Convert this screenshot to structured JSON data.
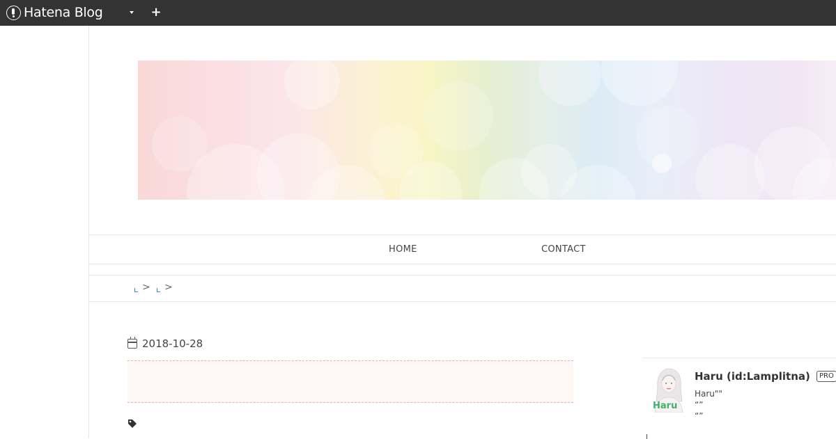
{
  "topbar": {
    "logo_text": "Hatena Blog",
    "logo_icon": "hatena-logo-icon",
    "menu_caret_icon": "caret-down-icon",
    "add_icon": "plus-icon",
    "add_glyph": "+"
  },
  "nav": {
    "items": [
      {
        "label": "HOME"
      },
      {
        "label": "CONTACT"
      }
    ]
  },
  "breadcrumb": {
    "separators": [
      ">",
      ">"
    ]
  },
  "article": {
    "date": "2018-10-28",
    "calendar_icon": "calendar-icon",
    "title": "",
    "tag_icon": "tag-icon"
  },
  "profile": {
    "name": "Haru (id:Lamplitna)",
    "badge": "PRO",
    "lines": [
      "Haru\"\"",
      "“”",
      "“”"
    ],
    "avatar_label": "Haru"
  },
  "colors": {
    "topbar_bg": "#333333",
    "title_box_bg": "#fff7f6",
    "title_box_border": "#e6b3ad",
    "breadcrumb_link": "#2a8bb8"
  }
}
